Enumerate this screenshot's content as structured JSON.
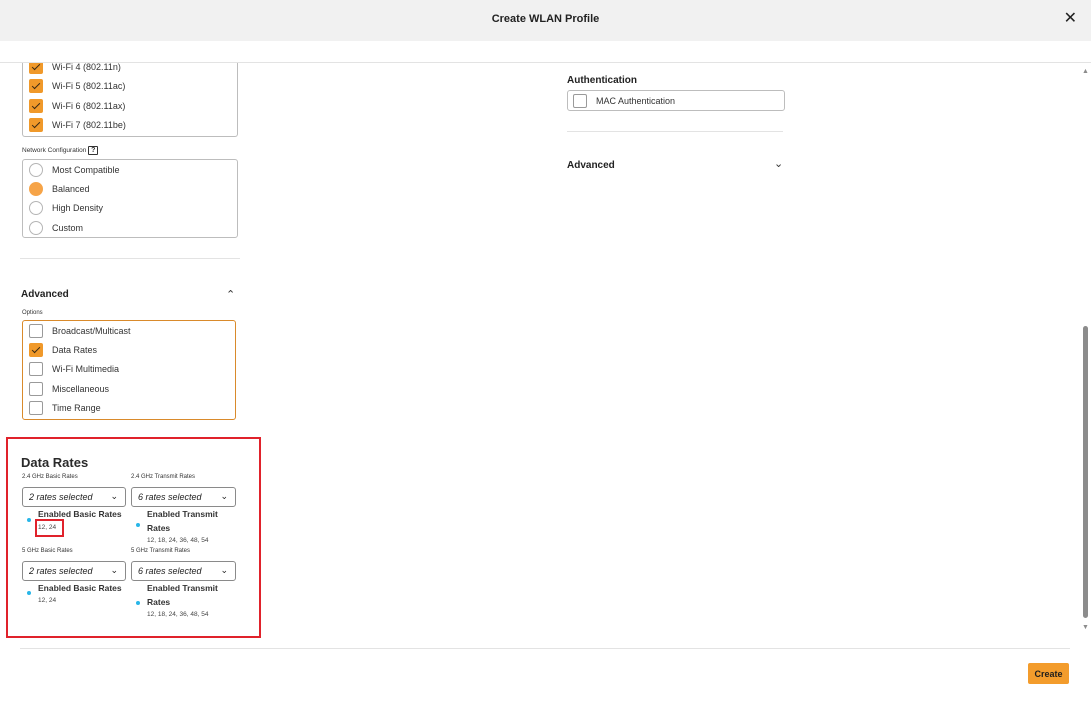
{
  "dialog": {
    "title": "Create WLAN Profile",
    "close_label": "✕"
  },
  "wifi_standards": [
    {
      "label": "Wi-Fi 4 (802.11n)",
      "checked": true
    },
    {
      "label": "Wi-Fi 5 (802.11ac)",
      "checked": true
    },
    {
      "label": "Wi-Fi 6 (802.11ax)",
      "checked": true
    },
    {
      "label": "Wi-Fi 7 (802.11be)",
      "checked": true
    }
  ],
  "network_config": {
    "label": "Network Configuration",
    "help": "?",
    "options": [
      {
        "label": "Most Compatible",
        "selected": false
      },
      {
        "label": "Balanced",
        "selected": true
      },
      {
        "label": "High Density",
        "selected": false
      },
      {
        "label": "Custom",
        "selected": false
      }
    ]
  },
  "advanced_left": {
    "title": "Advanced",
    "chevron": "^",
    "options_label": "Options",
    "options": [
      {
        "label": "Broadcast/Multicast",
        "checked": false
      },
      {
        "label": "Data Rates",
        "checked": true
      },
      {
        "label": "Wi-Fi Multimedia",
        "checked": false
      },
      {
        "label": "Miscellaneous",
        "checked": false
      },
      {
        "label": "Time Range",
        "checked": false
      }
    ]
  },
  "data_rates": {
    "title": "Data Rates",
    "ghz24_basic": {
      "label": "2.4 GHz Basic Rates",
      "selected": "2 rates selected",
      "enabled_label": "Enabled Basic Rates",
      "values": "12, 24"
    },
    "ghz24_transmit": {
      "label": "2.4 GHz Transmit Rates",
      "selected": "6 rates selected",
      "enabled_label_1": "Enabled Transmit",
      "enabled_label_2": "Rates",
      "values": "12, 18, 24, 36, 48, 54"
    },
    "ghz5_basic": {
      "label": "5 GHz Basic Rates",
      "selected": "2 rates selected",
      "enabled_label": "Enabled Basic Rates",
      "values": "12, 24"
    },
    "ghz5_transmit": {
      "label": "5 GHz Transmit Rates",
      "selected": "6 rates selected",
      "enabled_label_1": "Enabled Transmit",
      "enabled_label_2": "Rates",
      "values": "12, 18, 24, 36, 48, 54"
    }
  },
  "authentication": {
    "title": "Authentication",
    "mac_label": "MAC Authentication",
    "mac_checked": false
  },
  "advanced_right": {
    "title": "Advanced",
    "chevron": "v"
  },
  "footer": {
    "create_label": "Create"
  },
  "colors": {
    "accent": "#f39c2c",
    "highlight": "#e0222b",
    "dot": "#28b6e8"
  }
}
